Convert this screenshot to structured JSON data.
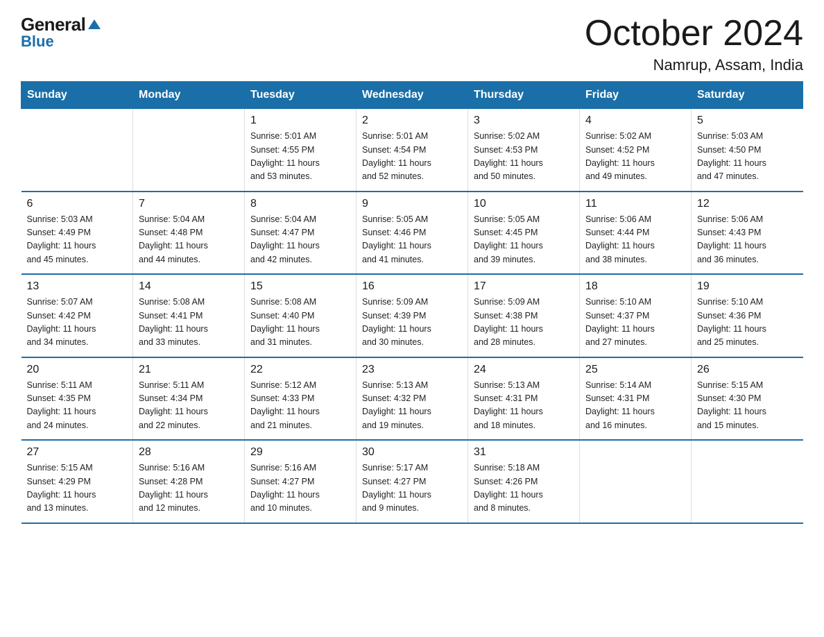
{
  "header": {
    "logo": {
      "general": "General",
      "blue": "Blue"
    },
    "title": "October 2024",
    "subtitle": "Namrup, Assam, India"
  },
  "days_of_week": [
    "Sunday",
    "Monday",
    "Tuesday",
    "Wednesday",
    "Thursday",
    "Friday",
    "Saturday"
  ],
  "weeks": [
    [
      {
        "day": "",
        "info": ""
      },
      {
        "day": "",
        "info": ""
      },
      {
        "day": "1",
        "info": "Sunrise: 5:01 AM\nSunset: 4:55 PM\nDaylight: 11 hours\nand 53 minutes."
      },
      {
        "day": "2",
        "info": "Sunrise: 5:01 AM\nSunset: 4:54 PM\nDaylight: 11 hours\nand 52 minutes."
      },
      {
        "day": "3",
        "info": "Sunrise: 5:02 AM\nSunset: 4:53 PM\nDaylight: 11 hours\nand 50 minutes."
      },
      {
        "day": "4",
        "info": "Sunrise: 5:02 AM\nSunset: 4:52 PM\nDaylight: 11 hours\nand 49 minutes."
      },
      {
        "day": "5",
        "info": "Sunrise: 5:03 AM\nSunset: 4:50 PM\nDaylight: 11 hours\nand 47 minutes."
      }
    ],
    [
      {
        "day": "6",
        "info": "Sunrise: 5:03 AM\nSunset: 4:49 PM\nDaylight: 11 hours\nand 45 minutes."
      },
      {
        "day": "7",
        "info": "Sunrise: 5:04 AM\nSunset: 4:48 PM\nDaylight: 11 hours\nand 44 minutes."
      },
      {
        "day": "8",
        "info": "Sunrise: 5:04 AM\nSunset: 4:47 PM\nDaylight: 11 hours\nand 42 minutes."
      },
      {
        "day": "9",
        "info": "Sunrise: 5:05 AM\nSunset: 4:46 PM\nDaylight: 11 hours\nand 41 minutes."
      },
      {
        "day": "10",
        "info": "Sunrise: 5:05 AM\nSunset: 4:45 PM\nDaylight: 11 hours\nand 39 minutes."
      },
      {
        "day": "11",
        "info": "Sunrise: 5:06 AM\nSunset: 4:44 PM\nDaylight: 11 hours\nand 38 minutes."
      },
      {
        "day": "12",
        "info": "Sunrise: 5:06 AM\nSunset: 4:43 PM\nDaylight: 11 hours\nand 36 minutes."
      }
    ],
    [
      {
        "day": "13",
        "info": "Sunrise: 5:07 AM\nSunset: 4:42 PM\nDaylight: 11 hours\nand 34 minutes."
      },
      {
        "day": "14",
        "info": "Sunrise: 5:08 AM\nSunset: 4:41 PM\nDaylight: 11 hours\nand 33 minutes."
      },
      {
        "day": "15",
        "info": "Sunrise: 5:08 AM\nSunset: 4:40 PM\nDaylight: 11 hours\nand 31 minutes."
      },
      {
        "day": "16",
        "info": "Sunrise: 5:09 AM\nSunset: 4:39 PM\nDaylight: 11 hours\nand 30 minutes."
      },
      {
        "day": "17",
        "info": "Sunrise: 5:09 AM\nSunset: 4:38 PM\nDaylight: 11 hours\nand 28 minutes."
      },
      {
        "day": "18",
        "info": "Sunrise: 5:10 AM\nSunset: 4:37 PM\nDaylight: 11 hours\nand 27 minutes."
      },
      {
        "day": "19",
        "info": "Sunrise: 5:10 AM\nSunset: 4:36 PM\nDaylight: 11 hours\nand 25 minutes."
      }
    ],
    [
      {
        "day": "20",
        "info": "Sunrise: 5:11 AM\nSunset: 4:35 PM\nDaylight: 11 hours\nand 24 minutes."
      },
      {
        "day": "21",
        "info": "Sunrise: 5:11 AM\nSunset: 4:34 PM\nDaylight: 11 hours\nand 22 minutes."
      },
      {
        "day": "22",
        "info": "Sunrise: 5:12 AM\nSunset: 4:33 PM\nDaylight: 11 hours\nand 21 minutes."
      },
      {
        "day": "23",
        "info": "Sunrise: 5:13 AM\nSunset: 4:32 PM\nDaylight: 11 hours\nand 19 minutes."
      },
      {
        "day": "24",
        "info": "Sunrise: 5:13 AM\nSunset: 4:31 PM\nDaylight: 11 hours\nand 18 minutes."
      },
      {
        "day": "25",
        "info": "Sunrise: 5:14 AM\nSunset: 4:31 PM\nDaylight: 11 hours\nand 16 minutes."
      },
      {
        "day": "26",
        "info": "Sunrise: 5:15 AM\nSunset: 4:30 PM\nDaylight: 11 hours\nand 15 minutes."
      }
    ],
    [
      {
        "day": "27",
        "info": "Sunrise: 5:15 AM\nSunset: 4:29 PM\nDaylight: 11 hours\nand 13 minutes."
      },
      {
        "day": "28",
        "info": "Sunrise: 5:16 AM\nSunset: 4:28 PM\nDaylight: 11 hours\nand 12 minutes."
      },
      {
        "day": "29",
        "info": "Sunrise: 5:16 AM\nSunset: 4:27 PM\nDaylight: 11 hours\nand 10 minutes."
      },
      {
        "day": "30",
        "info": "Sunrise: 5:17 AM\nSunset: 4:27 PM\nDaylight: 11 hours\nand 9 minutes."
      },
      {
        "day": "31",
        "info": "Sunrise: 5:18 AM\nSunset: 4:26 PM\nDaylight: 11 hours\nand 8 minutes."
      },
      {
        "day": "",
        "info": ""
      },
      {
        "day": "",
        "info": ""
      }
    ]
  ]
}
